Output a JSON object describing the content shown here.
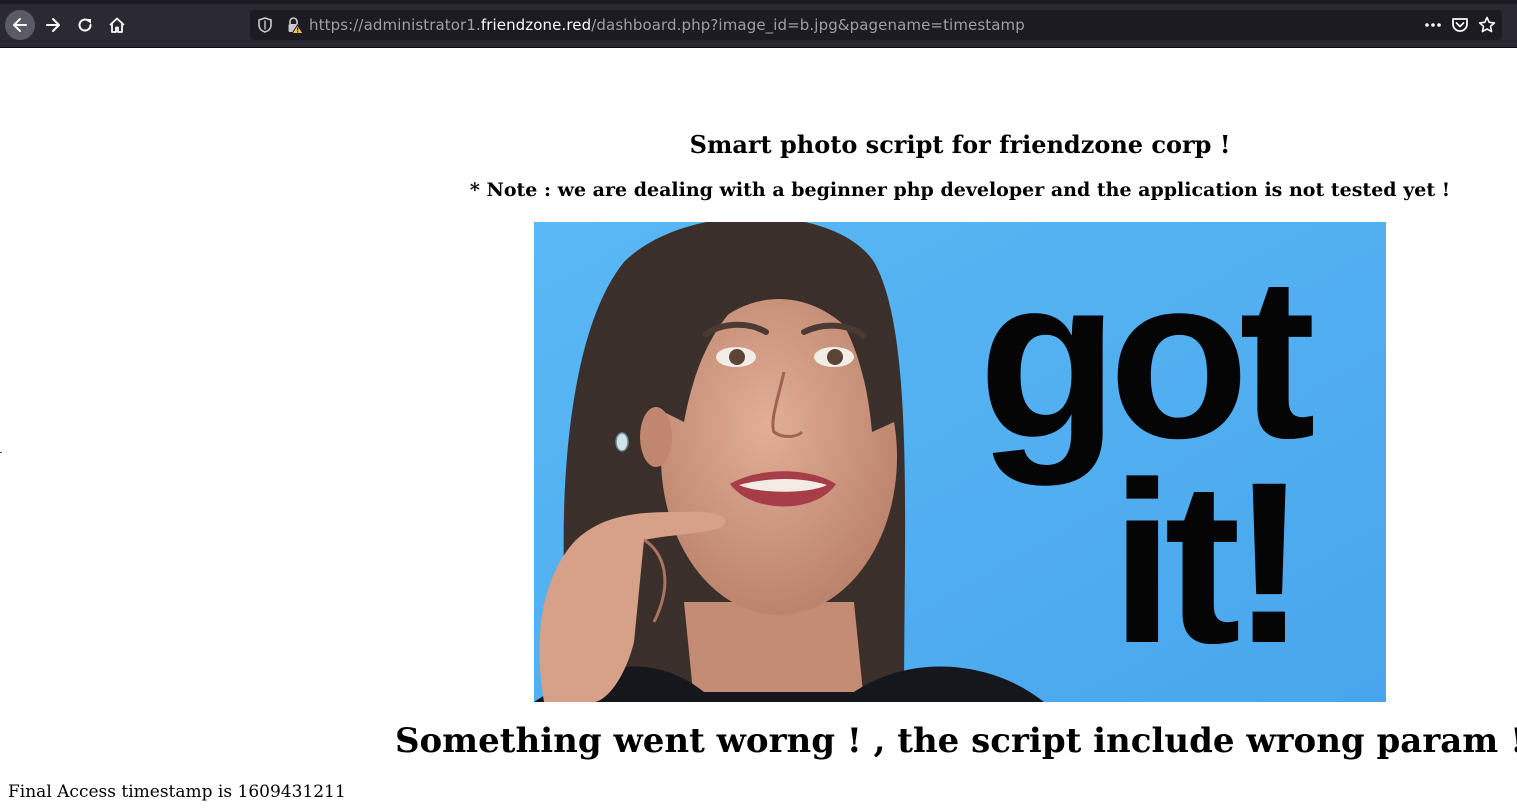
{
  "browser": {
    "url_prefix": "https://administrator1.",
    "url_host": "friendzone.red",
    "url_suffix": "/dashboard.php?image_id=b.jpg&pagename=timestamp",
    "icons": [
      "back-icon",
      "forward-icon",
      "reload-icon",
      "home-icon",
      "shield-icon",
      "insecure-lock-icon",
      "more-icon",
      "pocket-icon",
      "bookmark-star-icon"
    ]
  },
  "page": {
    "title": "Smart photo script for friendzone corp !",
    "note": "* Note : we are dealing with a beginner php developer and the application is not tested yet !",
    "photo_caption": "got it!",
    "photo_line1": "got",
    "photo_line2": "it!",
    "error_message": "Something went worng ! , the script include wrong param !",
    "timestamp_text": "Final Access timestamp is 1609431211"
  },
  "colors": {
    "toolbar": "#2b2a33",
    "urlbar": "#1c1b22",
    "photo_background": "#5cb6f2"
  }
}
